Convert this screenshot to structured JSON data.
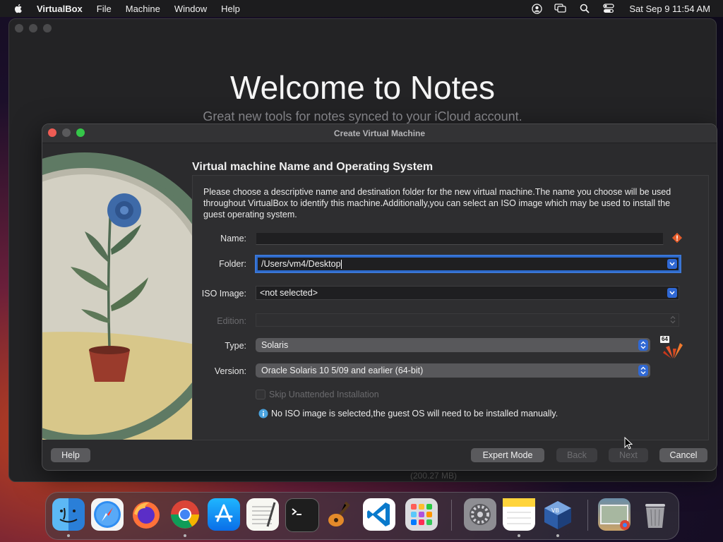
{
  "menubar": {
    "app": "VirtualBox",
    "items": [
      "File",
      "Machine",
      "Window",
      "Help"
    ],
    "clock": "Sat Sep 9  11:54 AM",
    "status_icons": [
      "user-icon",
      "screen-mirror-icon",
      "search-icon",
      "control-center-icon"
    ]
  },
  "notes": {
    "title": "Welcome to Notes",
    "subtitle": "Great new tools for notes synced to your iCloud account.",
    "footer_fragment": "(200.27 MB)"
  },
  "dialog": {
    "title": "Create Virtual Machine",
    "section_title": "Virtual machine Name and Operating System",
    "description": "Please choose a descriptive name and destination folder for the new virtual machine.The name you choose will be used throughout VirtualBox to identify this machine.Additionally,you can select an ISO image which may be used to install the guest operating system.",
    "fields": {
      "name_label": "Name:",
      "name_value": "",
      "folder_label": "Folder:",
      "folder_value": "/Users/vm4/Desktop",
      "iso_label": "ISO Image:",
      "iso_value": "<not selected>",
      "edition_label": "Edition:",
      "edition_value": "",
      "type_label": "Type:",
      "type_value": "Solaris",
      "version_label": "Version:",
      "version_value": "Oracle Solaris 10 5/09 and earlier (64-bit)",
      "os_badge": "64"
    },
    "skip_unattended": {
      "label": "Skip Unattended Installation",
      "checked": false
    },
    "info_message": "No ISO image is selected,the guest OS will need to be installed manually.",
    "buttons": {
      "help": "Help",
      "expert": "Expert Mode",
      "back": "Back",
      "next": "Next",
      "cancel": "Cancel"
    }
  },
  "dock": {
    "apps": [
      "Finder",
      "Safari",
      "Firefox",
      "Chrome",
      "App Store",
      "TextEdit",
      "Terminal",
      "GarageBand",
      "Visual Studio Code",
      "Launchpad",
      "System Settings",
      "Notes",
      "VirtualBox",
      "Downloads",
      "Trash"
    ]
  }
}
